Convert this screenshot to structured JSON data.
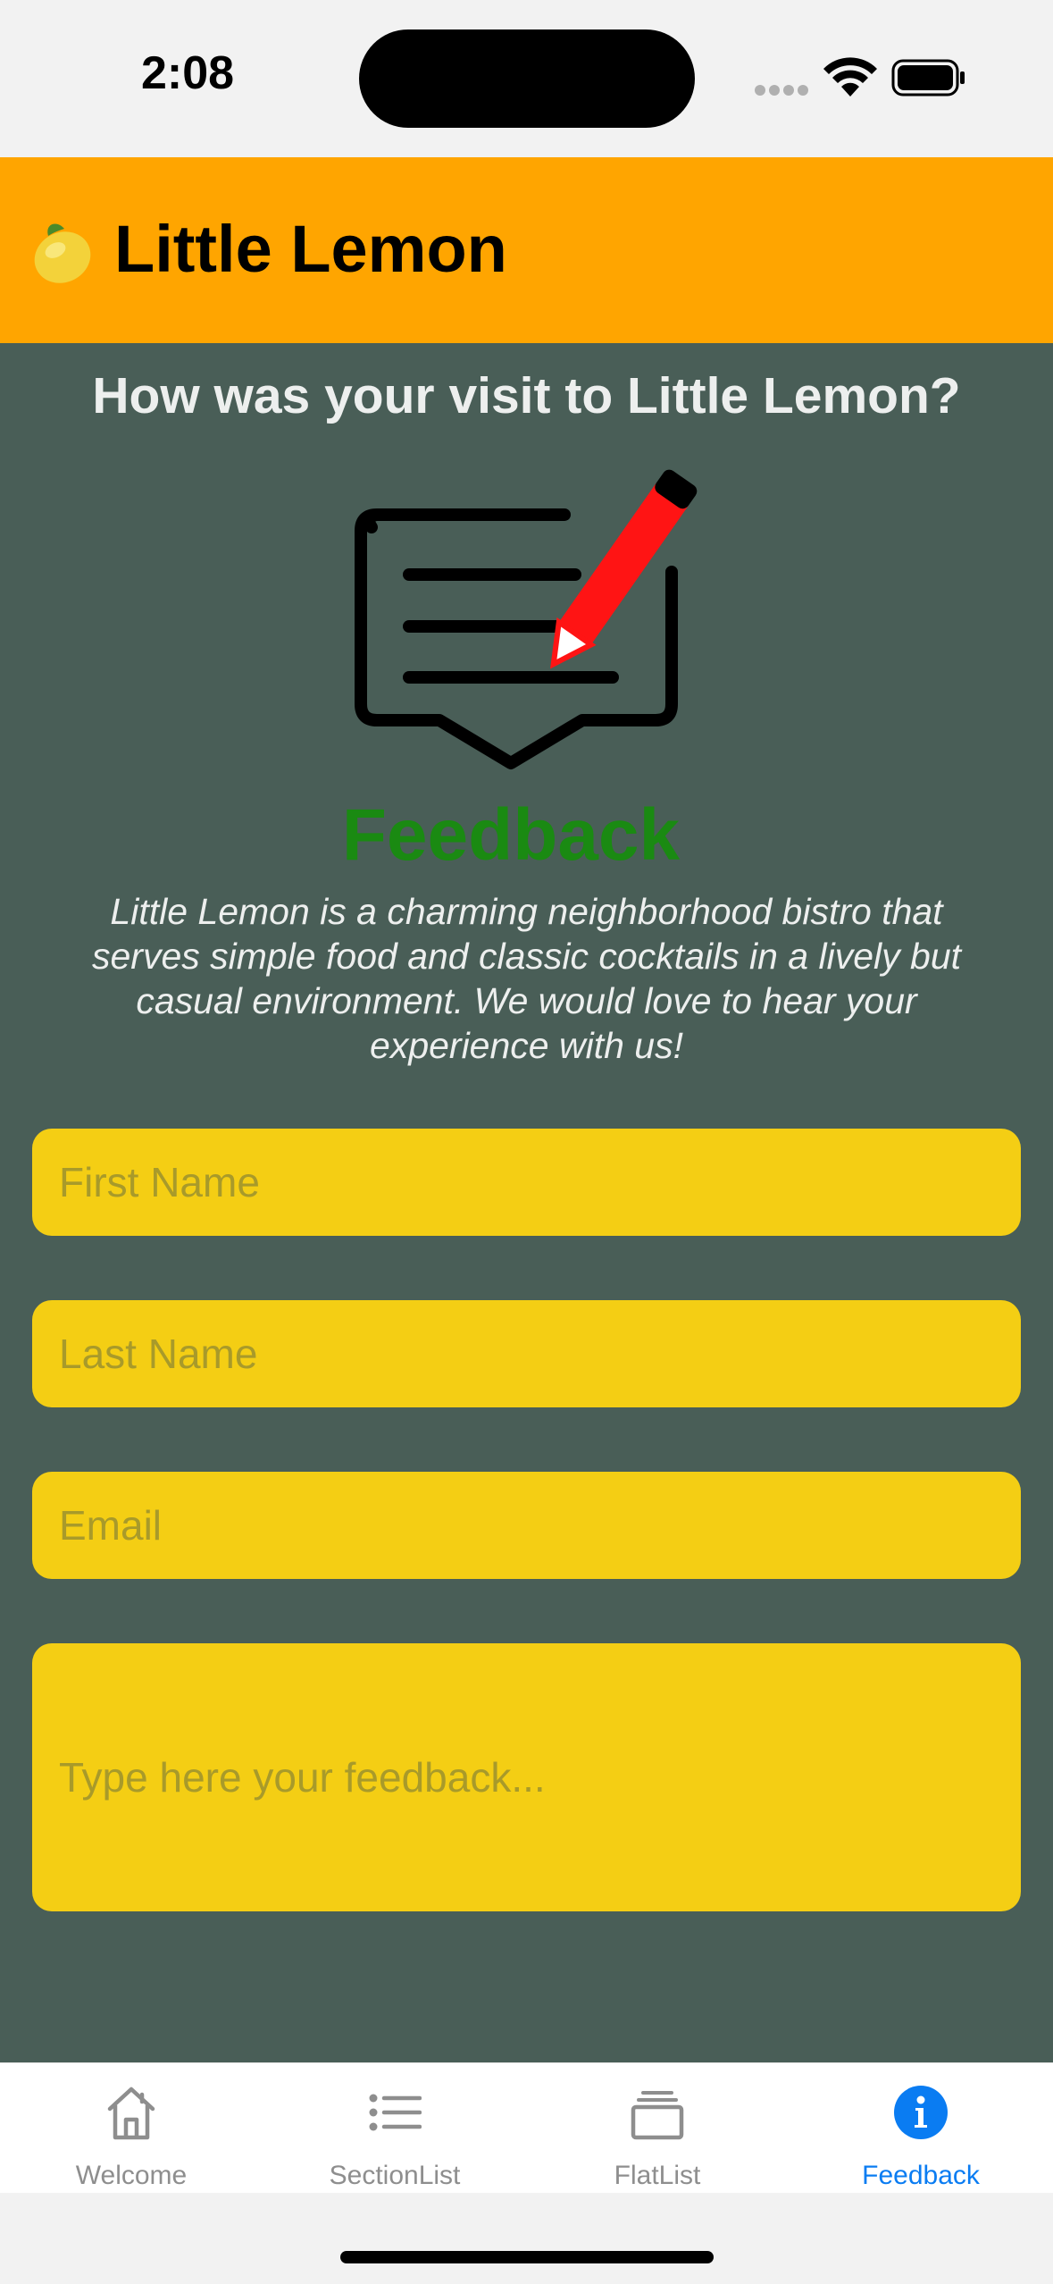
{
  "status_bar": {
    "time": "2:08",
    "icons": [
      "signal-dots-icon",
      "wifi-icon",
      "battery-icon"
    ]
  },
  "header": {
    "logo_icon": "lemon-icon",
    "title": "Little Lemon",
    "background": "#FFA500"
  },
  "main": {
    "background": "#495E57",
    "heading": "How was your visit to Little Lemon?",
    "graphic_icon": "feedback-pencil-icon",
    "graphic_word": "Feedback",
    "intro": "Little Lemon is a charming neighborhood bistro that serves simple food and classic cocktails in a lively but casual environment. We would love to hear your experience with us!"
  },
  "form": {
    "field_color": "#F4CE14",
    "first_name": {
      "value": "",
      "placeholder": "First Name"
    },
    "last_name": {
      "value": "",
      "placeholder": "Last Name"
    },
    "email": {
      "value": "",
      "placeholder": "Email"
    },
    "message": {
      "value": "",
      "placeholder": "Type here your feedback..."
    }
  },
  "tabs": {
    "items": [
      {
        "label": "Welcome",
        "icon": "home-icon",
        "active": false
      },
      {
        "label": "SectionList",
        "icon": "list-icon",
        "active": false
      },
      {
        "label": "FlatList",
        "icon": "stack-icon",
        "active": false
      },
      {
        "label": "Feedback",
        "icon": "info-icon",
        "active": true
      }
    ],
    "active_color": "#0a7cf2",
    "inactive_color": "#8e8e8e"
  }
}
